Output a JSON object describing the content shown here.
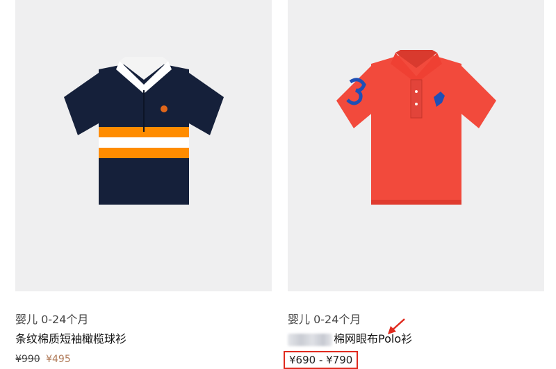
{
  "products": [
    {
      "category": "婴儿 0-24个月",
      "title": "条纹棉质短袖橄榄球衫",
      "price_original": "¥990",
      "price_sale": "¥495",
      "colors": {
        "navy": "#15203a",
        "orange": "#ff8c00",
        "white": "#ffffff",
        "logo": "#e0661a"
      }
    },
    {
      "category": "婴儿 0-24个月",
      "title_visible": "棉网眼布Polo衫",
      "price_range": "¥690 - ¥790",
      "colors": {
        "body": "#f24a3c",
        "logo": "#1f4fb5",
        "highlight": "#e02a1e"
      }
    }
  ]
}
